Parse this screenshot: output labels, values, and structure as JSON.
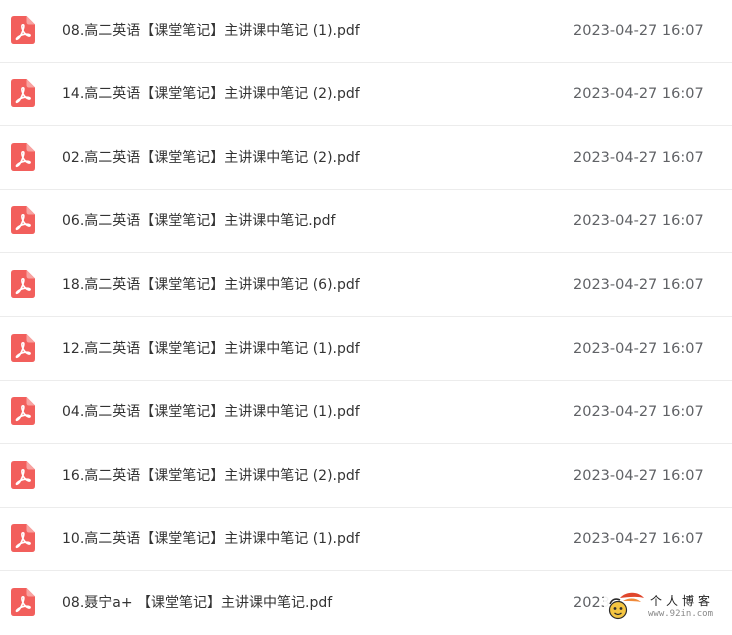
{
  "icons": {
    "file_type_icon": "pdf-file-icon",
    "pdf_color": "#f25f5c"
  },
  "files": [
    {
      "name": "08.高二英语【课堂笔记】主讲课中笔记 (1).pdf",
      "modified": "2023-04-27 16:07"
    },
    {
      "name": "14.高二英语【课堂笔记】主讲课中笔记 (2).pdf",
      "modified": "2023-04-27 16:07"
    },
    {
      "name": "02.高二英语【课堂笔记】主讲课中笔记 (2).pdf",
      "modified": "2023-04-27 16:07"
    },
    {
      "name": "06.高二英语【课堂笔记】主讲课中笔记.pdf",
      "modified": "2023-04-27 16:07"
    },
    {
      "name": "18.高二英语【课堂笔记】主讲课中笔记 (6).pdf",
      "modified": "2023-04-27 16:07"
    },
    {
      "name": "12.高二英语【课堂笔记】主讲课中笔记 (1).pdf",
      "modified": "2023-04-27 16:07"
    },
    {
      "name": "04.高二英语【课堂笔记】主讲课中笔记 (1).pdf",
      "modified": "2023-04-27 16:07"
    },
    {
      "name": "16.高二英语【课堂笔记】主讲课中笔记 (2).pdf",
      "modified": "2023-04-27 16:07"
    },
    {
      "name": "10.高二英语【课堂笔记】主讲课中笔记 (1).pdf",
      "modified": "2023-04-27 16:07"
    },
    {
      "name": "08.聂宁a+ 【课堂笔记】主讲课中笔记.pdf",
      "modified": "2023"
    }
  ],
  "watermark": {
    "title": "个人博客",
    "url": "www.92in.com"
  }
}
